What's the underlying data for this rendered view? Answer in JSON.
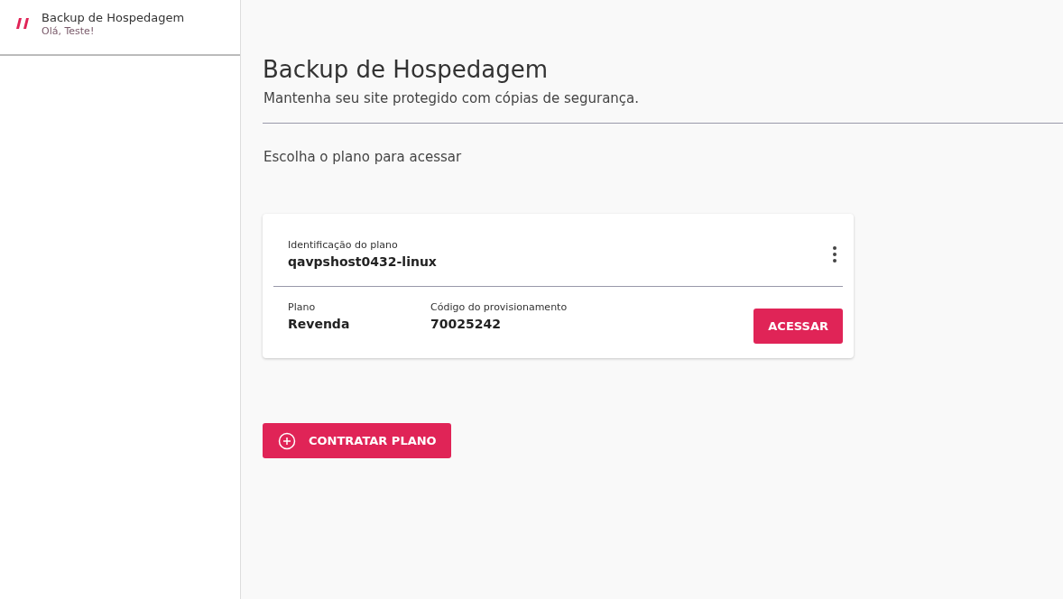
{
  "sidebar": {
    "title": "Backup de Hospedagem",
    "greeting": "Olá, Teste!"
  },
  "header": {
    "title": "Backup de Hospedagem",
    "subtitle": "Mantenha seu site protegido com cópias de segurança."
  },
  "prompt": "Escolha o plano para acessar",
  "plans": [
    {
      "id_label": "Identificação do plano",
      "id": "qavpshost0432-linux",
      "fields": [
        {
          "label": "Plano",
          "value": "Revenda"
        },
        {
          "label": "Código do provisionamento",
          "value": "70025242"
        }
      ],
      "action": "ACESSAR"
    }
  ],
  "add_button": "CONTRATAR PLANO"
}
